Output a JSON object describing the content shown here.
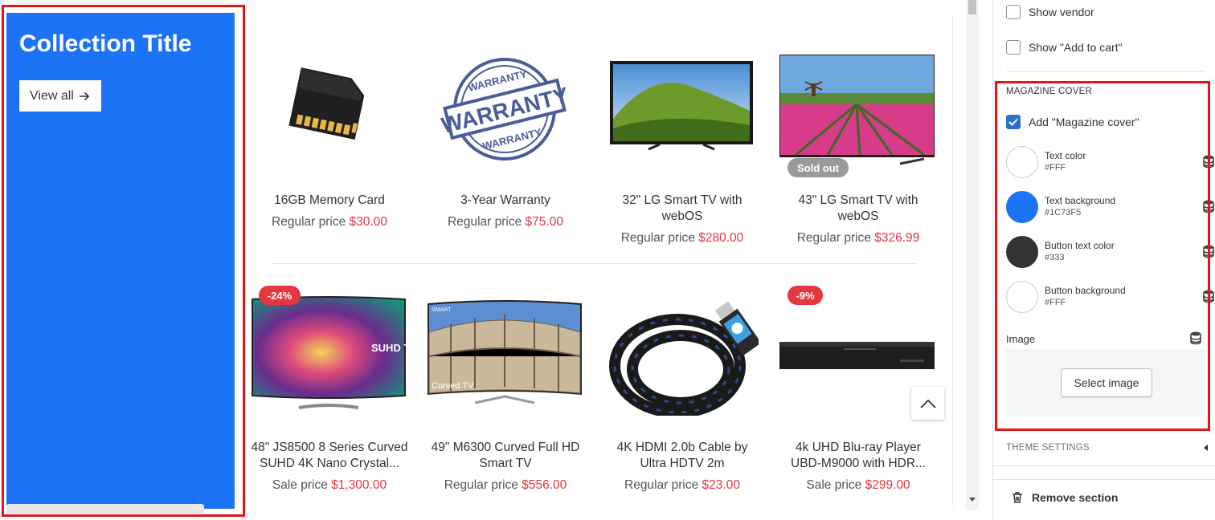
{
  "preview": {
    "collection_title": "Collection Title",
    "view_all_label": "View all",
    "products": [
      {
        "name": "16GB Memory Card",
        "price_label": "Regular price",
        "price": "$30.00"
      },
      {
        "name": "3-Year Warranty",
        "price_label": "Regular price",
        "price": "$75.00"
      },
      {
        "name": "32\" LG Smart TV with webOS",
        "price_label": "Regular price",
        "price": "$280.00"
      },
      {
        "name": "43\" LG Smart TV with webOS",
        "price_label": "Regular price",
        "price": "$326.99",
        "badge": "Sold out"
      },
      {
        "name": "48\" JS8500 8 Series Curved SUHD 4K Nano Crystal...",
        "price_label": "Sale price",
        "price": "$1,300.00",
        "badge": "-24%"
      },
      {
        "name": "49\" M6300 Curved Full HD Smart TV",
        "price_label": "Regular price",
        "price": "$556.00"
      },
      {
        "name": "4K HDMI 2.0b Cable by Ultra HDTV 2m",
        "price_label": "Regular price",
        "price": "$23.00"
      },
      {
        "name": "4k UHD Blu-ray Player UBD-M9000 with HDR...",
        "price_label": "Sale price",
        "price": "$299.00",
        "badge": "-9%"
      }
    ],
    "image_text": {
      "warranty": "WARRANTY",
      "suhd": "SUHD TV",
      "smart": "SMART",
      "curved_tv": "Curved TV"
    }
  },
  "panel": {
    "show_vendor": "Show vendor",
    "show_add_to_cart": "Show \"Add to cart\"",
    "magazine_heading": "MAGAZINE COVER",
    "add_magazine_cover": "Add \"Magazine cover\"",
    "colors": [
      {
        "label": "Text color",
        "value": "#FFF",
        "swatch": "#ffffff"
      },
      {
        "label": "Text background",
        "value": "#1C73F5",
        "swatch": "#1c73f5"
      },
      {
        "label": "Button text color",
        "value": "#333",
        "swatch": "#333333"
      },
      {
        "label": "Button background",
        "value": "#FFF",
        "swatch": "#ffffff"
      }
    ],
    "image_label": "Image",
    "select_image": "Select image",
    "theme_settings": "THEME SETTINGS",
    "remove_section": "Remove section"
  }
}
